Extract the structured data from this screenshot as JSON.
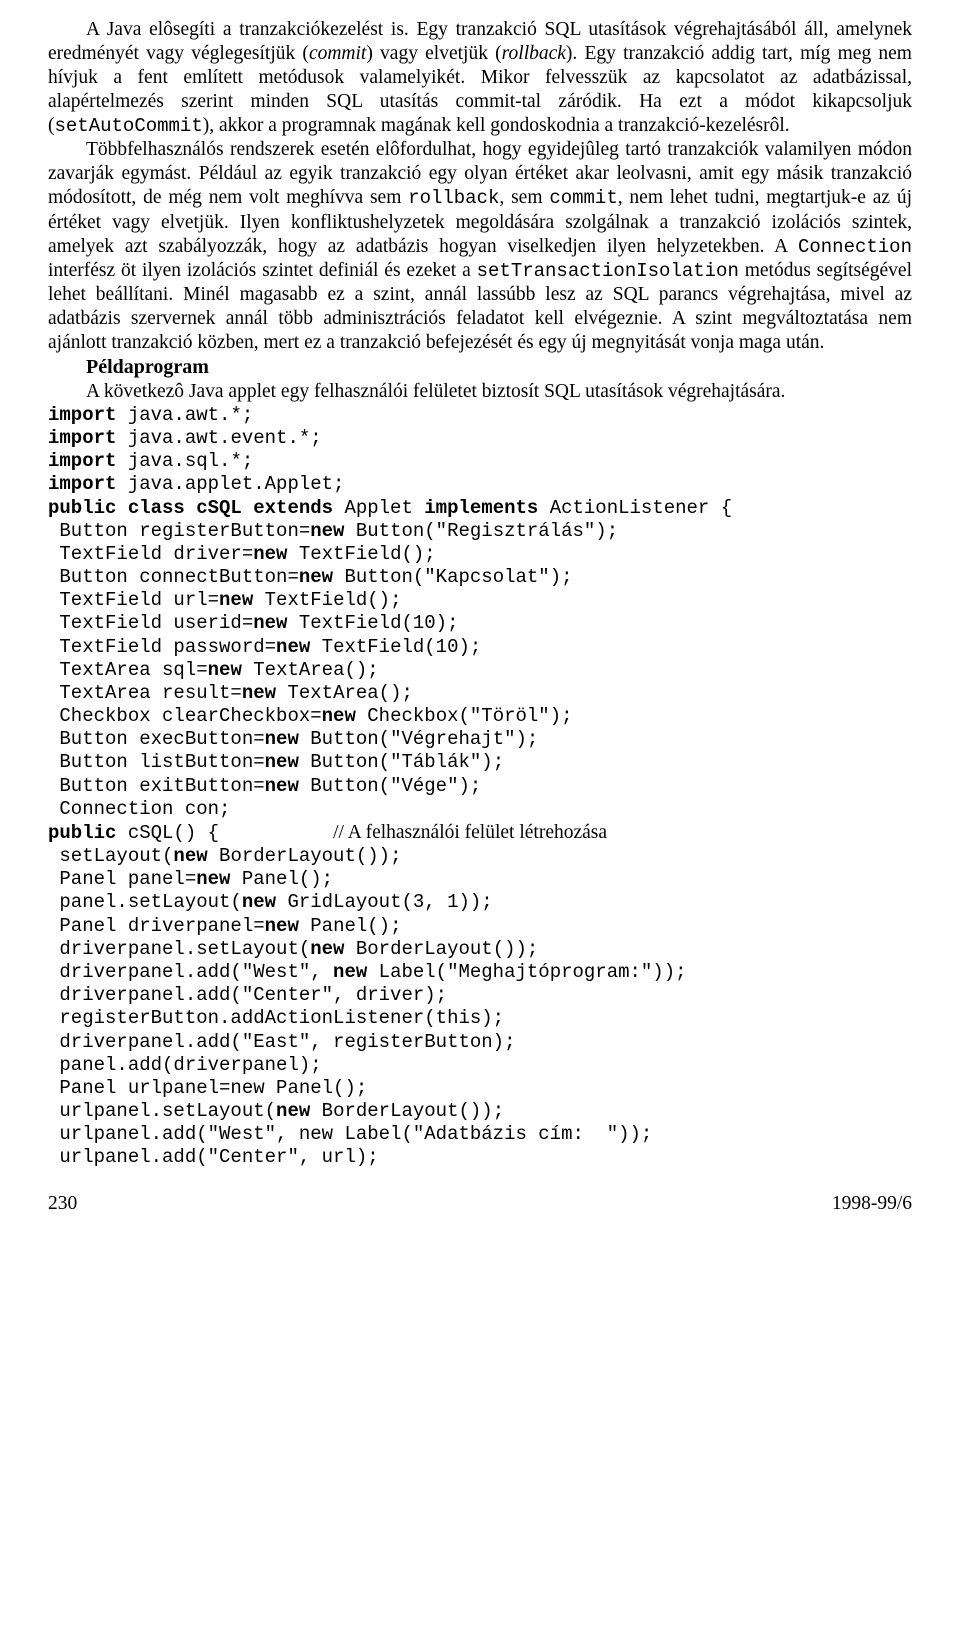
{
  "paras": [
    "A Java elôsegíti a tranzakciókezelést is. Egy tranzakció SQL utasítások végrehajtásából áll, amelynek eredményét vagy véglegesítjük (<i>commit</i>) vagy elvetjük (<i>rollback</i>). Egy tranzakció addig tart, míg meg nem hívjuk a fent említett metódusok valamelyikét. Mikor felvesszük az kapcsolatot az adatbázissal, alapértelmezés szerint minden SQL utasítás commit-tal záródik. Ha ezt a módot kikapcsoljuk (<m>setAutoCommit</m>), akkor a programnak magának kell gondoskodnia a tranzakció-kezelésrôl.",
    "Többfelhasználós rendszerek esetén elôfordulhat, hogy egyidejûleg tartó tranzakciók valamilyen módon zavarják egymást. Például az egyik tranzakció egy olyan értéket akar leolvasni, amit egy másik tranzakció módosított, de még nem volt meghívva sem <m>rollback</m>, sem <m>commit</m>, nem lehet tudni, megtartjuk-e az új értéket vagy elvetjük. Ilyen konfliktushelyzetek megoldására szolgálnak a tranzakció izolációs szintek, amelyek azt szabályozzák, hogy az adatbázis hogyan viselkedjen ilyen helyzetekben. A <m>Connection</m> interfész öt ilyen izolációs szintet definiál és ezeket a <m>setTransactionIsolation</m> metódus segítségével lehet beállítani. Minél magasabb ez a szint, annál lassúbb lesz az SQL parancs végrehajtása, mivel az adatbázis szervernek annál több adminisztrációs feladatot kell elvégeznie. A szint megváltoztatása nem ajánlott tranzakció közben, mert ez a tranzakció befejezését és egy új megnyitását vonja maga után."
  ],
  "heading": "Példaprogram",
  "intro_after_heading": "A következô Java applet egy felhasználói felületet biztosít SQL utasítások végrehajtására.",
  "code_imports": [
    {
      "kw": "import",
      "rest": " java.awt.*;"
    },
    {
      "kw": "import",
      "rest": " java.awt.event.*;"
    },
    {
      "kw": "import",
      "rest": " java.sql.*;"
    },
    {
      "kw": "import",
      "rest": " java.applet.Applet;"
    }
  ],
  "code_class_decl": {
    "pre": "public class cSQL extends ",
    "mid": "Applet ",
    "post": "implements ",
    "tail": "ActionListener {"
  },
  "code_fields": [
    {
      "pre": " Button registerButton=",
      "kw": "new",
      "post": " Button(\"Regisztrálás\");"
    },
    {
      "pre": " TextField driver=",
      "kw": "new",
      "post": " TextField();"
    },
    {
      "pre": " Button connectButton=",
      "kw": "new",
      "post": " Button(\"Kapcsolat\");"
    },
    {
      "pre": " TextField url=",
      "kw": "new",
      "post": " TextField();"
    },
    {
      "pre": " TextField userid=",
      "kw": "new",
      "post": " TextField(10);"
    },
    {
      "pre": " TextField password=",
      "kw": "new",
      "post": " TextField(10);"
    },
    {
      "pre": " TextArea sql=",
      "kw": "new",
      "post": " TextArea();"
    },
    {
      "pre": " TextArea result=",
      "kw": "new",
      "post": " TextArea();"
    },
    {
      "pre": " Checkbox clearCheckbox=",
      "kw": "new",
      "post": " Checkbox(\"Töröl\");"
    },
    {
      "pre": " Button execButton=",
      "kw": "new",
      "post": " Button(\"Végrehajt\");"
    },
    {
      "pre": " Button listButton=",
      "kw": "new",
      "post": " Button(\"Táblák\");"
    },
    {
      "pre": " Button exitButton=",
      "kw": "new",
      "post": " Button(\"Vége\");"
    },
    {
      "pre": " Connection con;",
      "kw": "",
      "post": ""
    }
  ],
  "code_ctor_sig": {
    "pre": "public",
    "mid": " cSQL() {",
    "gap": "          ",
    "comment": "// A felhasználói felület létrehozása"
  },
  "code_ctor_body": [
    {
      "pre": " setLayout(",
      "kw": "new",
      "post": " BorderLayout());"
    },
    {
      "pre": " Panel panel=",
      "kw": "new",
      "post": " Panel();"
    },
    {
      "pre": " panel.setLayout(",
      "kw": "new",
      "post": " GridLayout(3, 1));"
    },
    {
      "pre": " Panel driverpanel=",
      "kw": "new",
      "post": " Panel();"
    },
    {
      "pre": " driverpanel.setLayout(",
      "kw": "new",
      "post": " BorderLayout());"
    },
    {
      "pre": " driverpanel.add(\"West\", ",
      "kw": "new",
      "post": " Label(\"Meghajtóprogram:\"));"
    },
    {
      "pre": " driverpanel.add(\"Center\", driver);",
      "kw": "",
      "post": ""
    },
    {
      "pre": " registerButton.addActionListener(this);",
      "kw": "",
      "post": ""
    },
    {
      "pre": " driverpanel.add(\"East\", registerButton);",
      "kw": "",
      "post": ""
    },
    {
      "pre": " panel.add(driverpanel);",
      "kw": "",
      "post": ""
    },
    {
      "pre": " Panel urlpanel=new Panel();",
      "kw": "",
      "post": ""
    },
    {
      "pre": " urlpanel.setLayout(",
      "kw": "new",
      "post": " BorderLayout());"
    },
    {
      "pre": " urlpanel.add(\"West\", new Label(\"Adatbázis cím:  \"));",
      "kw": "",
      "post": ""
    },
    {
      "pre": " urlpanel.add(\"Center\", url);",
      "kw": "",
      "post": ""
    }
  ],
  "footer": {
    "page": "230",
    "issue": "1998-99/6"
  }
}
